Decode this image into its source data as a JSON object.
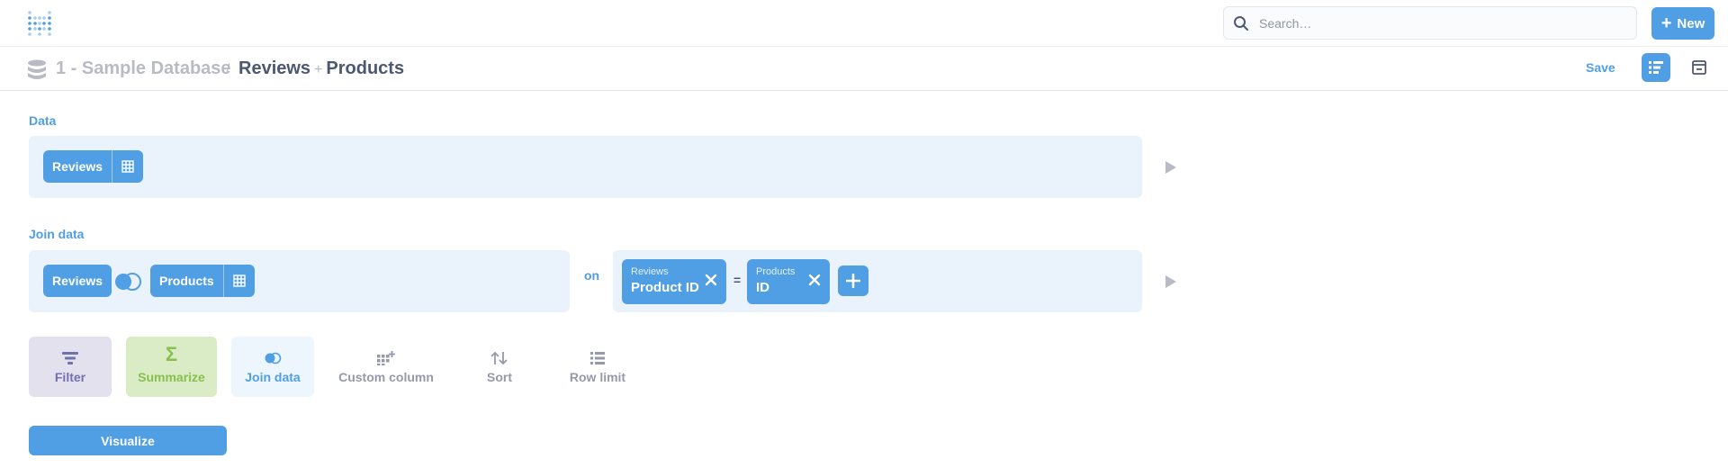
{
  "colors": {
    "brand": "#509ee3",
    "panel_bg": "#eaf3fc",
    "filter": "#7172ad",
    "summarize": "#88bf4d",
    "muted_text": "#949aab"
  },
  "topbar": {
    "logo_icon": "metabase-logo-icon",
    "search": {
      "placeholder": "Search…",
      "value": "",
      "icon": "search-icon"
    },
    "new_button": {
      "label": "New",
      "icon": "plus-icon"
    }
  },
  "header": {
    "database_icon": "database-icon",
    "database": "1 - Sample Database",
    "separator": "/",
    "title_left": "Reviews",
    "title_plus": "+",
    "title_right": "Products",
    "save_label": "Save",
    "notebook_icon": "notebook-icon",
    "sql_icon": "sql-preview-icon"
  },
  "data_section": {
    "label": "Data",
    "table": "Reviews"
  },
  "join_section": {
    "label": "Join data",
    "left_table": "Reviews",
    "join_type_icon": "left-join-icon",
    "right_table": "Products",
    "on_label": "on",
    "left_condition": {
      "table": "Reviews",
      "column": "Product ID"
    },
    "operator": "=",
    "right_condition": {
      "table": "Products",
      "column": "ID"
    }
  },
  "actions": [
    {
      "label": "Filter",
      "icon": "filter-icon"
    },
    {
      "label": "Summarize",
      "icon": "sigma-icon"
    },
    {
      "label": "Join data",
      "icon": "join-icon"
    },
    {
      "label": "Custom column",
      "icon": "add-column-icon"
    },
    {
      "label": "Sort",
      "icon": "sort-icon"
    },
    {
      "label": "Row limit",
      "icon": "list-icon"
    }
  ],
  "visualize_label": "Visualize"
}
